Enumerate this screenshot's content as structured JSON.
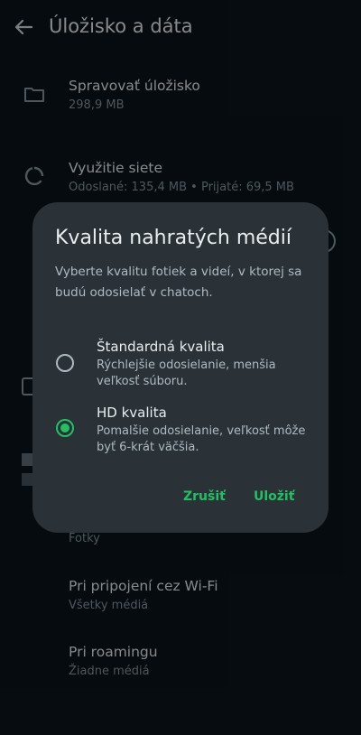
{
  "appbar": {
    "title": "Úložisko a dáta",
    "back_icon": "arrow-back-icon"
  },
  "settings": {
    "manage_storage": {
      "title": "Spravovať úložisko",
      "subtitle": "298,9 MB",
      "icon": "folder-icon"
    },
    "network_usage": {
      "title": "Využitie siete",
      "subtitle": "Odoslané: 135,4 MB • Prijaté: 69,5 MB",
      "icon": "data-usage-icon"
    },
    "photos_peek": "Fotky",
    "wifi": {
      "title": "Pri pripojení cez Wi-Fi",
      "subtitle": "Všetky médiá"
    },
    "roaming": {
      "title": "Pri roamingu",
      "subtitle": "Žiadne médiá"
    }
  },
  "dialog": {
    "title": "Kvalita nahratých médií",
    "body": "Vyberte kvalitu fotiek a videí, v ktorej sa budú odosielať v chatoch.",
    "options": [
      {
        "title": "Štandardná kvalita",
        "subtitle": "Rýchlejšie odosielanie, menšia veľkosť súboru.",
        "selected": false
      },
      {
        "title": "HD kvalita",
        "subtitle": "Pomalšie odosielanie, veľkosť môže byť 6-krát väčšia.",
        "selected": true
      }
    ],
    "cancel_label": "Zrušiť",
    "save_label": "Uložiť"
  },
  "colors": {
    "background": "#0b141a",
    "dialog": "#2a3238",
    "accent": "#21c063",
    "text_primary": "#e9edef",
    "text_secondary": "#8696a0"
  }
}
